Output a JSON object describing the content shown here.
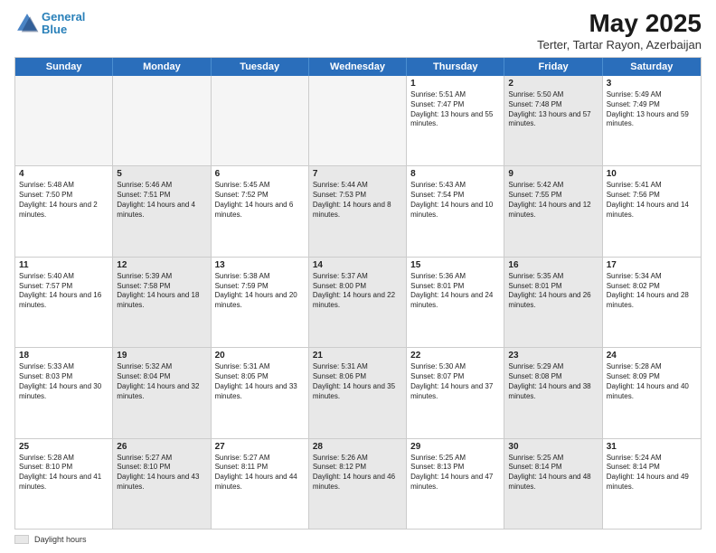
{
  "header": {
    "logo_line1": "General",
    "logo_line2": "Blue",
    "title": "May 2025",
    "subtitle": "Terter, Tartar Rayon, Azerbaijan"
  },
  "weekdays": [
    "Sunday",
    "Monday",
    "Tuesday",
    "Wednesday",
    "Thursday",
    "Friday",
    "Saturday"
  ],
  "legend_label": "Daylight hours",
  "rows": [
    [
      {
        "day": "",
        "info": "",
        "empty": true
      },
      {
        "day": "",
        "info": "",
        "empty": true
      },
      {
        "day": "",
        "info": "",
        "empty": true
      },
      {
        "day": "",
        "info": "",
        "empty": true
      },
      {
        "day": "1",
        "info": "Sunrise: 5:51 AM\nSunset: 7:47 PM\nDaylight: 13 hours and 55 minutes.",
        "shaded": false
      },
      {
        "day": "2",
        "info": "Sunrise: 5:50 AM\nSunset: 7:48 PM\nDaylight: 13 hours and 57 minutes.",
        "shaded": true
      },
      {
        "day": "3",
        "info": "Sunrise: 5:49 AM\nSunset: 7:49 PM\nDaylight: 13 hours and 59 minutes.",
        "shaded": false
      }
    ],
    [
      {
        "day": "4",
        "info": "Sunrise: 5:48 AM\nSunset: 7:50 PM\nDaylight: 14 hours and 2 minutes.",
        "shaded": false
      },
      {
        "day": "5",
        "info": "Sunrise: 5:46 AM\nSunset: 7:51 PM\nDaylight: 14 hours and 4 minutes.",
        "shaded": true
      },
      {
        "day": "6",
        "info": "Sunrise: 5:45 AM\nSunset: 7:52 PM\nDaylight: 14 hours and 6 minutes.",
        "shaded": false
      },
      {
        "day": "7",
        "info": "Sunrise: 5:44 AM\nSunset: 7:53 PM\nDaylight: 14 hours and 8 minutes.",
        "shaded": true
      },
      {
        "day": "8",
        "info": "Sunrise: 5:43 AM\nSunset: 7:54 PM\nDaylight: 14 hours and 10 minutes.",
        "shaded": false
      },
      {
        "day": "9",
        "info": "Sunrise: 5:42 AM\nSunset: 7:55 PM\nDaylight: 14 hours and 12 minutes.",
        "shaded": true
      },
      {
        "day": "10",
        "info": "Sunrise: 5:41 AM\nSunset: 7:56 PM\nDaylight: 14 hours and 14 minutes.",
        "shaded": false
      }
    ],
    [
      {
        "day": "11",
        "info": "Sunrise: 5:40 AM\nSunset: 7:57 PM\nDaylight: 14 hours and 16 minutes.",
        "shaded": false
      },
      {
        "day": "12",
        "info": "Sunrise: 5:39 AM\nSunset: 7:58 PM\nDaylight: 14 hours and 18 minutes.",
        "shaded": true
      },
      {
        "day": "13",
        "info": "Sunrise: 5:38 AM\nSunset: 7:59 PM\nDaylight: 14 hours and 20 minutes.",
        "shaded": false
      },
      {
        "day": "14",
        "info": "Sunrise: 5:37 AM\nSunset: 8:00 PM\nDaylight: 14 hours and 22 minutes.",
        "shaded": true
      },
      {
        "day": "15",
        "info": "Sunrise: 5:36 AM\nSunset: 8:01 PM\nDaylight: 14 hours and 24 minutes.",
        "shaded": false
      },
      {
        "day": "16",
        "info": "Sunrise: 5:35 AM\nSunset: 8:01 PM\nDaylight: 14 hours and 26 minutes.",
        "shaded": true
      },
      {
        "day": "17",
        "info": "Sunrise: 5:34 AM\nSunset: 8:02 PM\nDaylight: 14 hours and 28 minutes.",
        "shaded": false
      }
    ],
    [
      {
        "day": "18",
        "info": "Sunrise: 5:33 AM\nSunset: 8:03 PM\nDaylight: 14 hours and 30 minutes.",
        "shaded": false
      },
      {
        "day": "19",
        "info": "Sunrise: 5:32 AM\nSunset: 8:04 PM\nDaylight: 14 hours and 32 minutes.",
        "shaded": true
      },
      {
        "day": "20",
        "info": "Sunrise: 5:31 AM\nSunset: 8:05 PM\nDaylight: 14 hours and 33 minutes.",
        "shaded": false
      },
      {
        "day": "21",
        "info": "Sunrise: 5:31 AM\nSunset: 8:06 PM\nDaylight: 14 hours and 35 minutes.",
        "shaded": true
      },
      {
        "day": "22",
        "info": "Sunrise: 5:30 AM\nSunset: 8:07 PM\nDaylight: 14 hours and 37 minutes.",
        "shaded": false
      },
      {
        "day": "23",
        "info": "Sunrise: 5:29 AM\nSunset: 8:08 PM\nDaylight: 14 hours and 38 minutes.",
        "shaded": true
      },
      {
        "day": "24",
        "info": "Sunrise: 5:28 AM\nSunset: 8:09 PM\nDaylight: 14 hours and 40 minutes.",
        "shaded": false
      }
    ],
    [
      {
        "day": "25",
        "info": "Sunrise: 5:28 AM\nSunset: 8:10 PM\nDaylight: 14 hours and 41 minutes.",
        "shaded": false
      },
      {
        "day": "26",
        "info": "Sunrise: 5:27 AM\nSunset: 8:10 PM\nDaylight: 14 hours and 43 minutes.",
        "shaded": true
      },
      {
        "day": "27",
        "info": "Sunrise: 5:27 AM\nSunset: 8:11 PM\nDaylight: 14 hours and 44 minutes.",
        "shaded": false
      },
      {
        "day": "28",
        "info": "Sunrise: 5:26 AM\nSunset: 8:12 PM\nDaylight: 14 hours and 46 minutes.",
        "shaded": true
      },
      {
        "day": "29",
        "info": "Sunrise: 5:25 AM\nSunset: 8:13 PM\nDaylight: 14 hours and 47 minutes.",
        "shaded": false
      },
      {
        "day": "30",
        "info": "Sunrise: 5:25 AM\nSunset: 8:14 PM\nDaylight: 14 hours and 48 minutes.",
        "shaded": true
      },
      {
        "day": "31",
        "info": "Sunrise: 5:24 AM\nSunset: 8:14 PM\nDaylight: 14 hours and 49 minutes.",
        "shaded": false
      }
    ]
  ]
}
